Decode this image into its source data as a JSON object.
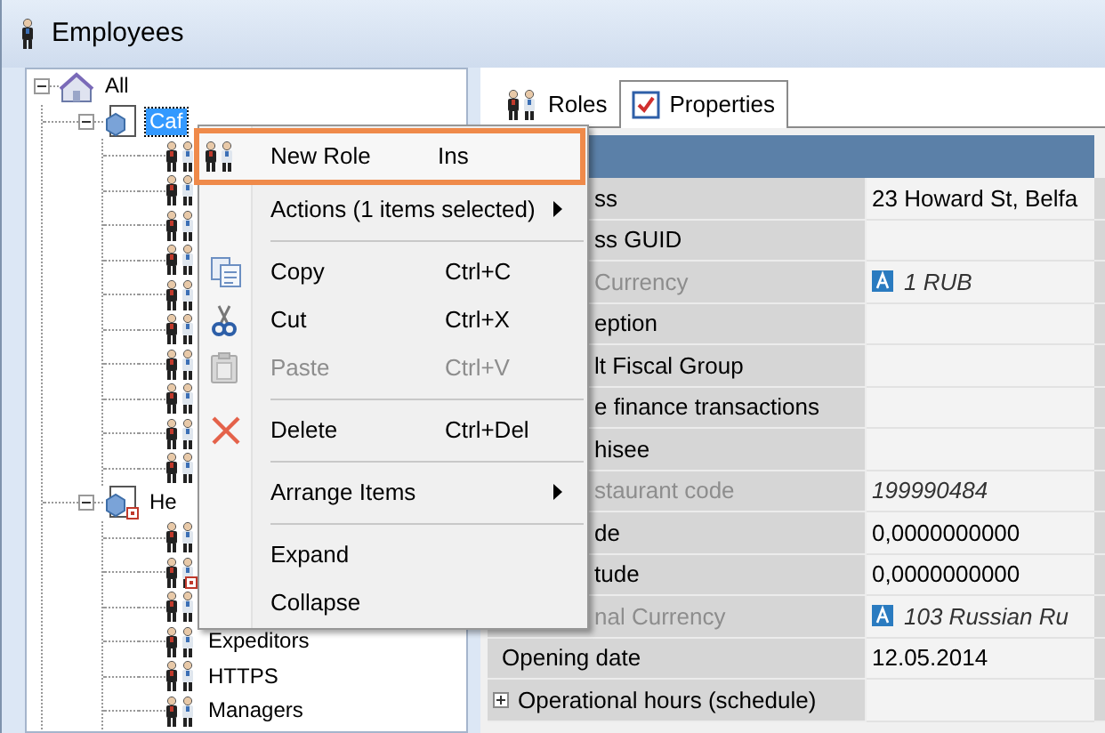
{
  "window": {
    "title": "Employees"
  },
  "tree": [
    {
      "label": "All",
      "kind": "site",
      "expanded": true,
      "selected": false,
      "children": [
        {
          "label": "Caf",
          "kind": "group",
          "expanded": true,
          "selected": true,
          "marked": false,
          "children": [
            {
              "kind": "role",
              "marked": false
            },
            {
              "kind": "role",
              "marked": false
            },
            {
              "kind": "role",
              "marked": false
            },
            {
              "kind": "role",
              "marked": false
            },
            {
              "kind": "role",
              "marked": false
            },
            {
              "kind": "role",
              "marked": false
            },
            {
              "kind": "role",
              "marked": false
            },
            {
              "kind": "role",
              "marked": false
            },
            {
              "kind": "role",
              "marked": false
            },
            {
              "kind": "role",
              "marked": false
            }
          ]
        },
        {
          "label": "He",
          "kind": "group",
          "expanded": true,
          "selected": false,
          "marked": true,
          "children": [
            {
              "kind": "role",
              "marked": false
            },
            {
              "kind": "role",
              "marked": true
            },
            {
              "kind": "role",
              "marked": false
            },
            {
              "label": "Expeditors",
              "kind": "role",
              "selected": false,
              "marked": false
            },
            {
              "label": "HTTPS",
              "kind": "role",
              "selected": false,
              "marked": false
            },
            {
              "label": "Managers",
              "kind": "role",
              "selected": false,
              "marked": false
            }
          ]
        }
      ]
    }
  ],
  "tabs": [
    {
      "label": "Roles",
      "kind": "roles",
      "selected": false
    },
    {
      "label": "Properties",
      "kind": "properties",
      "selected": true
    }
  ],
  "properties": [
    {
      "name": "ss",
      "value": "23 Howard St, Belfa",
      "disabled": false
    },
    {
      "name": "ss GUID",
      "disabled": false
    },
    {
      "name": "Currency",
      "value": "1 RUB",
      "kind": "currency",
      "disabled": true
    },
    {
      "name": "eption",
      "disabled": false
    },
    {
      "name": "lt Fiscal Group",
      "disabled": false
    },
    {
      "name": "e finance transactions",
      "disabled": false
    },
    {
      "name": "hisee",
      "disabled": false
    },
    {
      "name": "staurant code",
      "value": "199990484",
      "disabled": true
    },
    {
      "name": "de",
      "value": "0,0000000000",
      "disabled": false
    },
    {
      "name": "tude",
      "value": "0,0000000000",
      "disabled": false
    },
    {
      "name": "nal Currency",
      "value": "103 Russian Ru",
      "kind": "currency",
      "disabled": true
    },
    {
      "name": "Opening date",
      "value": "12.05.2014",
      "disabled": false
    },
    {
      "name": "Operational hours (schedule)",
      "kind": "expandable",
      "expanded": false,
      "disabled": false
    }
  ],
  "context_menu": [
    {
      "kind": "new-role",
      "label": "New Role",
      "shortcut": "Ins",
      "selected": true,
      "disabled": false
    },
    {
      "kind": "plain",
      "label": "Actions (1 items selected)",
      "submenu": true,
      "selected": false,
      "disabled": false
    },
    {
      "kind": "separator"
    },
    {
      "kind": "copy",
      "label": "Copy",
      "shortcut": "Ctrl+C",
      "selected": false,
      "disabled": false
    },
    {
      "kind": "cut",
      "label": "Cut",
      "shortcut": "Ctrl+X",
      "selected": false,
      "disabled": false
    },
    {
      "kind": "paste",
      "label": "Paste",
      "shortcut": "Ctrl+V",
      "selected": false,
      "disabled": true
    },
    {
      "kind": "separator"
    },
    {
      "kind": "delete",
      "label": "Delete",
      "shortcut": "Ctrl+Del",
      "selected": false,
      "disabled": false
    },
    {
      "kind": "separator"
    },
    {
      "kind": "plain",
      "label": "Arrange Items",
      "submenu": true,
      "selected": false,
      "disabled": false
    },
    {
      "kind": "separator"
    },
    {
      "kind": "plain",
      "label": "Expand",
      "selected": false,
      "disabled": false
    },
    {
      "kind": "plain",
      "label": "Collapse",
      "selected": false,
      "disabled": false
    }
  ]
}
